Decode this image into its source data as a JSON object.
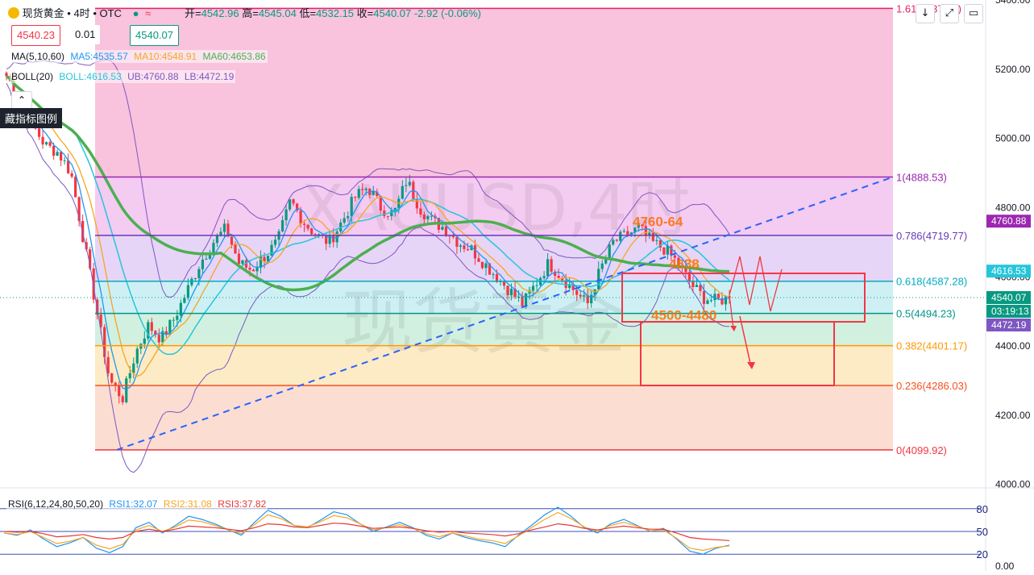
{
  "header": {
    "symbol": "现货黄金",
    "sep1": "•",
    "interval": "4时",
    "sep2": "•",
    "source": "OTC",
    "open_label": "开=",
    "open": "4542.96",
    "high_label": "高=",
    "high": "4545.04",
    "low_label": "低=",
    "low": "4532.15",
    "close_label": "收=",
    "close": "4540.07",
    "change": "-2.92 (-0.06%)",
    "sell_price": "4540.23",
    "spread": "0.01",
    "buy_price": "4540.07",
    "toolbar_icons": [
      "arrow-down-icon",
      "expand-icon",
      "screenshot-icon"
    ]
  },
  "indicators": {
    "ma_label": "MA(5,10,60)",
    "ma5": "MA5:4535.57",
    "ma10": "MA10:4548.91",
    "ma60": "MA60:4653.86",
    "boll_label": "BOLL(20)",
    "boll": "BOLL:4616.53",
    "ub": "UB:4760.88",
    "lb": "LB:4472.19",
    "hide_legend_tooltip": "藏指标图例",
    "rsi_label": "RSI(6,12,24,80,50,20)",
    "rsi1": "RSI1:32.07",
    "rsi2": "RSI2:31.08",
    "rsi3": "RSI3:37.82"
  },
  "colors": {
    "up": "#089981",
    "down": "#f23645",
    "ma5": "#2196f3",
    "ma10": "#f5a623",
    "ma60": "#4caf50",
    "boll_mid": "#26c6da",
    "boll_band": "#7e57c2",
    "trendline": "#2962ff",
    "annotation": "#ff6d00",
    "box": "#f23645"
  },
  "watermark": {
    "line1": "XAUUSD,4时",
    "line2": "现货黄金"
  },
  "chart_data": [
    {
      "type": "candlestick",
      "price_axis_ticks": [
        4000,
        4200,
        4400,
        4600,
        4800,
        5000,
        5200,
        5400
      ],
      "price_axis_labels": [
        "4000.00",
        "4200.00",
        "4400.00",
        "4600.00",
        "4800.00",
        "5000.00",
        "5200.00",
        "5400.00"
      ],
      "ylim": [
        3990,
        5400
      ],
      "close_path": [
        5180,
        5120,
        5040,
        4980,
        4960,
        4900,
        4700,
        4500,
        4300,
        4250,
        4380,
        4460,
        4420,
        4480,
        4560,
        4640,
        4700,
        4740,
        4640,
        4620,
        4660,
        4700,
        4820,
        4760,
        4720,
        4700,
        4760,
        4830,
        4860,
        4800,
        4780,
        4880,
        4800,
        4760,
        4740,
        4700,
        4680,
        4640,
        4600,
        4560,
        4520,
        4580,
        4640,
        4600,
        4560,
        4520,
        4620,
        4700,
        4720,
        4740,
        4700,
        4680,
        4640,
        4580,
        4540,
        4530,
        4540
      ],
      "fibonacci": [
        {
          "level": "1.618",
          "value": 5375.9,
          "label": "1.618(5375.9)",
          "color": "#e91e63"
        },
        {
          "level": "1",
          "value": 4888.53,
          "label": "1(4888.53)",
          "color": "#9c27b0"
        },
        {
          "level": "0.786",
          "value": 4719.77,
          "label": "0.786(4719.77)",
          "color": "#673ab7"
        },
        {
          "level": "0.618",
          "value": 4587.28,
          "label": "0.618(4587.28)",
          "color": "#00acc1"
        },
        {
          "level": "0.5",
          "value": 4494.23,
          "label": "0.5(4494.23)",
          "color": "#009688"
        },
        {
          "level": "0.382",
          "value": 4401.17,
          "label": "0.382(4401.17)",
          "color": "#ff9800"
        },
        {
          "level": "0.236",
          "value": 4286.03,
          "label": "0.236(4286.03)",
          "color": "#f4511e"
        },
        {
          "level": "0",
          "value": 4099.92,
          "label": "0(4099.92)",
          "color": "#f23645"
        }
      ],
      "price_tags": [
        {
          "value": 4760.88,
          "label": "4760.88",
          "color": "#9c27b0"
        },
        {
          "value": 4616.53,
          "label": "4616.53",
          "color": "#26c6da"
        },
        {
          "value": 4540.07,
          "label": "4540.07",
          "color": "#089981"
        },
        {
          "value": 4520,
          "label": "03:19:13",
          "color": "#089981"
        },
        {
          "value": 4472.19,
          "label": "4472.19",
          "color": "#7e57c2"
        }
      ],
      "annotations": [
        {
          "text": "4760-64",
          "value": 4760
        },
        {
          "text": "4638",
          "value": 4638
        },
        {
          "text": "4500-4480",
          "value": 4490
        }
      ],
      "boxes": [
        {
          "name": "upper-range-box",
          "top": 4610,
          "bottom": 4470
        },
        {
          "name": "lower-target-box",
          "top": 4470,
          "bottom": 4286
        }
      ]
    },
    {
      "type": "line",
      "title": "RSI(6,12,24,80,50,20)",
      "ylim": [
        0,
        100
      ],
      "levels": [
        80,
        50,
        20
      ],
      "level_labels": [
        "80",
        "50",
        "20"
      ],
      "axis_bottom_label": "0.00",
      "series": [
        {
          "name": "RSI1",
          "values": [
            48,
            45,
            52,
            40,
            30,
            35,
            42,
            28,
            22,
            30,
            55,
            62,
            48,
            58,
            70,
            66,
            60,
            52,
            45,
            62,
            78,
            70,
            58,
            55,
            65,
            76,
            72,
            60,
            50,
            56,
            62,
            55,
            45,
            40,
            48,
            42,
            38,
            35,
            30,
            45,
            58,
            72,
            82,
            70,
            55,
            48,
            60,
            66,
            58,
            50,
            54,
            40,
            24,
            20,
            28,
            32
          ]
        },
        {
          "name": "RSI2",
          "values": [
            48,
            46,
            50,
            42,
            34,
            37,
            42,
            32,
            27,
            33,
            52,
            58,
            50,
            56,
            65,
            63,
            58,
            52,
            47,
            59,
            72,
            67,
            58,
            56,
            63,
            71,
            68,
            60,
            52,
            55,
            59,
            54,
            47,
            43,
            48,
            44,
            40,
            38,
            34,
            44,
            55,
            66,
            75,
            67,
            56,
            50,
            58,
            62,
            57,
            51,
            52,
            41,
            28,
            25,
            29,
            31
          ]
        },
        {
          "name": "RSI3",
          "values": [
            50,
            49,
            50,
            47,
            43,
            44,
            46,
            42,
            40,
            42,
            50,
            53,
            50,
            53,
            57,
            56,
            55,
            53,
            51,
            55,
            60,
            59,
            56,
            55,
            58,
            61,
            60,
            57,
            54,
            55,
            56,
            54,
            51,
            49,
            50,
            48,
            47,
            46,
            44,
            47,
            52,
            56,
            60,
            58,
            54,
            52,
            55,
            57,
            55,
            53,
            53,
            48,
            42,
            40,
            39,
            38
          ]
        }
      ]
    }
  ]
}
